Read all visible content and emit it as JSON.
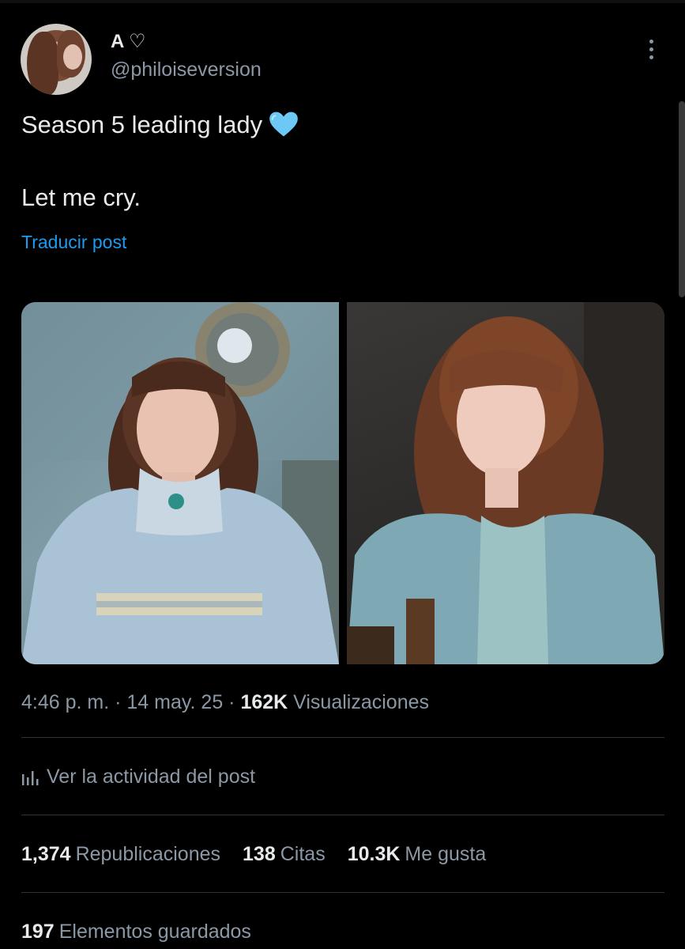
{
  "author": {
    "display_name": "A ♡",
    "handle": "@philoiseversion"
  },
  "post": {
    "line1": "Season 5 leading lady",
    "line2": "Let me cry.",
    "translate_label": "Traducir post"
  },
  "meta": {
    "time": "4:46 p. m.",
    "sep1": " · ",
    "date": "14 may. 25",
    "sep2": " · ",
    "views_count": "162K",
    "views_label": "Visualizaciones"
  },
  "activity_label": "Ver la actividad del post",
  "stats": {
    "reposts_count": "1,374",
    "reposts_label": "Republicaciones",
    "quotes_count": "138",
    "quotes_label": "Citas",
    "likes_count": "10.3K",
    "likes_label": "Me gusta",
    "bookmarks_count": "197",
    "bookmarks_label": "Elementos guardados"
  },
  "colors": {
    "background": "#000000",
    "text": "#e7e9ea",
    "muted": "#8b98a5",
    "link": "#1d9bf0",
    "heart": "#6ec8f5"
  },
  "icons": [
    "more-vertical-icon",
    "blue-heart-icon",
    "analytics-bars-icon"
  ]
}
